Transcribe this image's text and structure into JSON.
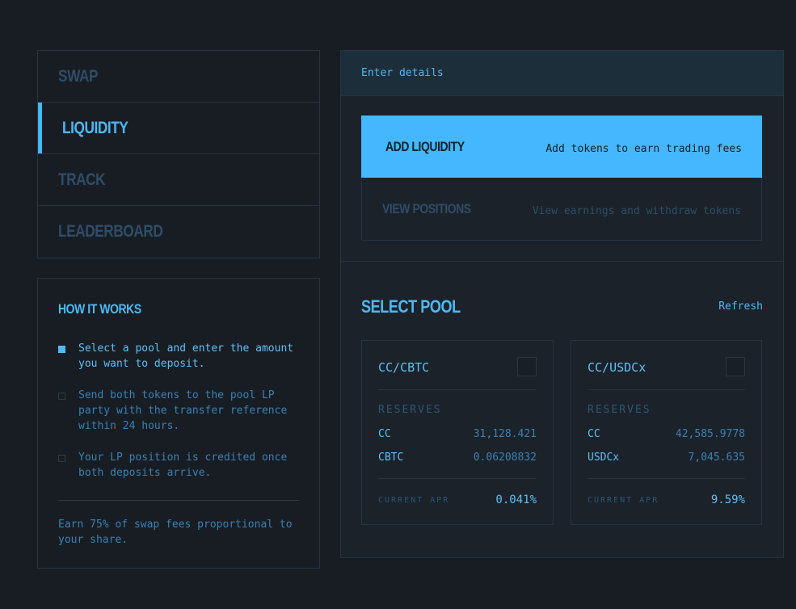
{
  "nav": {
    "items": [
      {
        "label": "SWAP"
      },
      {
        "label": "LIQUIDITY",
        "active": true
      },
      {
        "label": "TRACK"
      },
      {
        "label": "LEADERBOARD"
      }
    ]
  },
  "how": {
    "title": "HOW IT WORKS",
    "steps": [
      {
        "text": "Select a pool and enter the amount you want to deposit.",
        "active": true
      },
      {
        "text": "Send both tokens to the pool LP party with the transfer reference within 24 hours.",
        "active": false
      },
      {
        "text": "Your LP position is credited once both deposits arrive.",
        "active": false
      }
    ],
    "footer": "Earn 75% of swap fees proportional to your share."
  },
  "panel": {
    "header": "Enter details",
    "options": [
      {
        "title": "ADD LIQUIDITY",
        "desc": "Add tokens to earn trading fees",
        "selected": true
      },
      {
        "title": "VIEW POSITIONS",
        "desc": "View earnings and withdraw tokens",
        "selected": false
      }
    ],
    "select_title": "SELECT POOL",
    "refresh": "Refresh",
    "pools": [
      {
        "name": "CC/CBTC",
        "reserves_label": "RESERVES",
        "reserves": [
          {
            "token": "CC",
            "value": "31,128.421"
          },
          {
            "token": "CBTC",
            "value": "0.06208832"
          }
        ],
        "apr_label": "CURRENT APR",
        "apr": "0.041%"
      },
      {
        "name": "CC/USDCx",
        "reserves_label": "RESERVES",
        "reserves": [
          {
            "token": "CC",
            "value": "42,585.9778"
          },
          {
            "token": "USDCx",
            "value": "7,045.635"
          }
        ],
        "apr_label": "CURRENT APR",
        "apr": "9.59%"
      }
    ]
  },
  "colors": {
    "background": "#181d24",
    "accent": "#45b7ff",
    "muted": "#2e4d68"
  }
}
